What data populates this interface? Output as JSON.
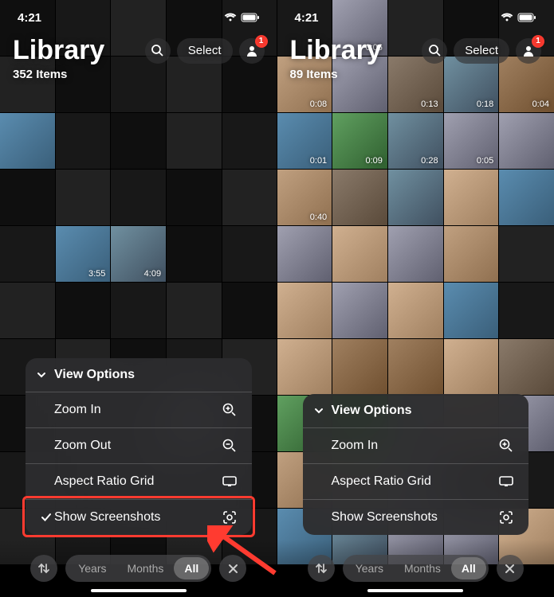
{
  "status": {
    "time": "4:21"
  },
  "left": {
    "title": "Library",
    "subtitle": "352 Items",
    "select": "Select",
    "badge": "1",
    "menu": {
      "header": "View Options",
      "items": [
        {
          "label": "Zoom In",
          "icon": "zoom-in",
          "checked": false
        },
        {
          "label": "Zoom Out",
          "icon": "zoom-out",
          "checked": false
        },
        {
          "label": "Aspect Ratio Grid",
          "icon": "aspect",
          "checked": false
        },
        {
          "label": "Show Screenshots",
          "icon": "screenshot",
          "checked": true
        }
      ]
    },
    "segments": {
      "years": "Years",
      "months": "Months",
      "all": "All"
    },
    "tile_durations": [
      "3:55",
      "4:09"
    ]
  },
  "right": {
    "title": "Library",
    "subtitle": "89 Items",
    "select": "Select",
    "badge": "1",
    "menu": {
      "header": "View Options",
      "items": [
        {
          "label": "Zoom In",
          "icon": "zoom-in",
          "checked": false
        },
        {
          "label": "Aspect Ratio Grid",
          "icon": "aspect",
          "checked": false
        },
        {
          "label": "Show Screenshots",
          "icon": "screenshot",
          "checked": false
        }
      ]
    },
    "segments": {
      "years": "Years",
      "months": "Months",
      "all": "All"
    },
    "tile_durations": [
      "0:06",
      "0:08",
      "0:13",
      "0:18",
      "0:04",
      "0:01",
      "0:09",
      "0:28",
      "0:05",
      "0:40"
    ]
  }
}
